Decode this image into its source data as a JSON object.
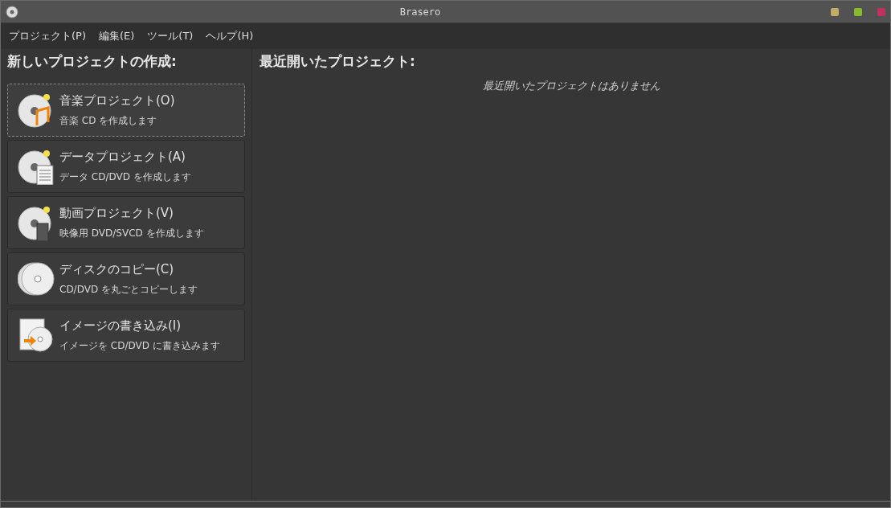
{
  "window": {
    "title": "Brasero"
  },
  "menu": [
    "プロジェクト(P)",
    "編集(E)",
    "ツール(T)",
    "ヘルプ(H)"
  ],
  "new_project": {
    "heading": "新しいプロジェクトの作成:",
    "items": [
      {
        "kind": "audio",
        "title": "音楽プロジェクト(O)",
        "subtitle": "音楽 CD を作成します",
        "selected": true
      },
      {
        "kind": "data",
        "title": "データプロジェクト(A)",
        "subtitle": "データ CD/DVD を作成します",
        "selected": false
      },
      {
        "kind": "video",
        "title": "動画プロジェクト(V)",
        "subtitle": "映像用 DVD/SVCD を作成します",
        "selected": false
      },
      {
        "kind": "copy",
        "title": "ディスクのコピー(C)",
        "subtitle": "CD/DVD を丸ごとコピーします",
        "selected": false
      },
      {
        "kind": "image",
        "title": "イメージの書き込み(I)",
        "subtitle": "イメージを CD/DVD に書き込みます",
        "selected": false
      }
    ]
  },
  "recent": {
    "heading": "最近開いたプロジェクト:",
    "empty_message": "最近開いたプロジェクトはありません"
  }
}
